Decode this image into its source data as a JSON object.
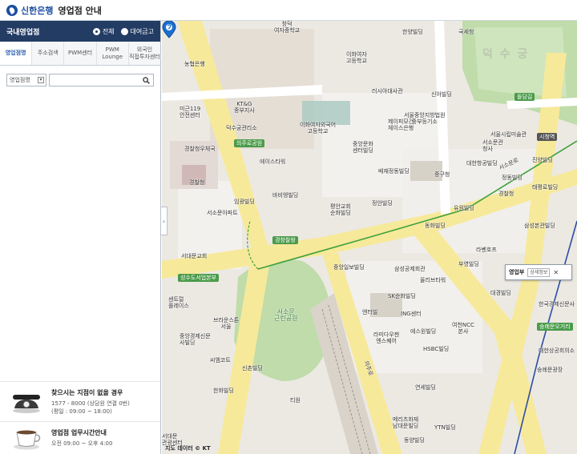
{
  "header": {
    "brand": "신한은행",
    "title": "영업점 안내"
  },
  "sidebar": {
    "section_title": "국내영업점",
    "radio_options": [
      {
        "label": "전체",
        "selected": true
      },
      {
        "label": "대여금고",
        "selected": false
      }
    ],
    "tabs": [
      {
        "label": "영업점명",
        "active": true
      },
      {
        "label": "주소검색",
        "active": false
      },
      {
        "label": "PWM센터",
        "active": false
      },
      {
        "label": "PWM\nLounge",
        "active": false
      },
      {
        "label": "외국인\n직접투자센터",
        "active": false
      }
    ],
    "search": {
      "select_value": "영업점명",
      "input_value": "",
      "input_placeholder": ""
    },
    "collapse_glyph": "‹",
    "call_info": {
      "title": "찾으시는 지점이 없을 경우",
      "line1": "1577 - 8000 (상담원 연결 0번)",
      "line2": "(평일 : 09:00 ~ 18:00)"
    },
    "hours_info": {
      "title": "영업점 업무시간안내",
      "line1": "오전 09:00 ~ 오후 4:00"
    }
  },
  "map": {
    "labels": {
      "big_deoksu": "덕 수 궁",
      "road_uiju": "의주로공원",
      "road_gyeongchang": "경창찰왕",
      "road_seosomun": "서소문공원",
      "road_sungnyemun": "숭례문오거리",
      "road_seosomun_bonbu": "성수도서업본부",
      "road_dolgil": "돌담길",
      "road_seosomunro": "서소문로",
      "road_uijuro2": "의주로",
      "station_seodaemun": "시청역",
      "park_seosomun": "서소문\n근린공원",
      "p1": "농협은행",
      "p2": "미근119\n안전센터",
      "p3": "경찰청",
      "p4": "경찰청우체국",
      "p5": "서소문아파트",
      "p6": "임광빌딩",
      "p7": "덕수궁관리소",
      "p8": "이화여자외국어\n고등학교",
      "p9": "러시아대사관",
      "p10": "중앙문화\n센터빌딩",
      "p11": "제이피모건\n체이스은행",
      "p12": "배재정동빌딩",
      "p13": "평안교회\n순화빌딩",
      "p14": "정안빌딩",
      "p15": "동화빌딩",
      "p16": "유원빌딩",
      "p17": "대한항공빌딩",
      "p18": "삼성본관빌딩",
      "p19": "중앙일보빌딩",
      "p20": "삼성공제회관",
      "p21": "올리브타워",
      "p22": "SK순화빌딩",
      "p23": "ING센터",
      "p24": "엔터빌",
      "p25": "에스원빌딩",
      "p26": "라미다우젠\n엔스퀘어",
      "p27": "HSBC빌딩",
      "p28": "여천NCC\n본사",
      "p29": "대경빌딩",
      "p30": "경찰청",
      "p31": "센트럴\n플레이스",
      "p32": "브라운스톤\n서울",
      "p33": "중앙경제신문\n사빌딩",
      "p34": "씨엠코트",
      "p35": "한화빌딩",
      "p36": "신촌빌딩",
      "p37": "연세빌딩",
      "p38": "메리츠화재\n남대문빌딩",
      "p39": "YTN빌딩",
      "p40": "티원",
      "p41": "한국경제신문사",
      "p42": "서울시립미술관",
      "p43": "대한상공회의소",
      "p44": "숭례문광장",
      "p45": "서소문관\n청사",
      "p46": "신아빌딩",
      "p47": "이화여자\n고등학교",
      "p48": "국세청",
      "p49": "한양빌딩",
      "p50": "창덕\n여자중학교",
      "p51": "서울중앙지방법원\n중부등기소",
      "p52": "서대문교회",
      "p53": "에이스타워",
      "p54": "바비엥빌딩",
      "p55": "KT&G\n중부지사",
      "p56": "진양빌딩",
      "p57": "동양빌딩",
      "p58": "태평로빌딩",
      "p59": "부영빌딩",
      "p60": "라벤호프",
      "p61": "중구청",
      "p62": "정동빌딩",
      "p63": "서대문\n관광센터"
    },
    "popup": {
      "branch_name": "영업부",
      "detail_button": "상세정보",
      "close": "✕"
    },
    "credit": "지도 데이터 © KT"
  },
  "colors": {
    "brand_blue": "#1c4da1",
    "header_navy": "#233c64",
    "road_yellow": "#f7e99a",
    "road_green": "#4a9b4a",
    "park_green": "#bfdcaa",
    "map_bg": "#ece9e3"
  }
}
